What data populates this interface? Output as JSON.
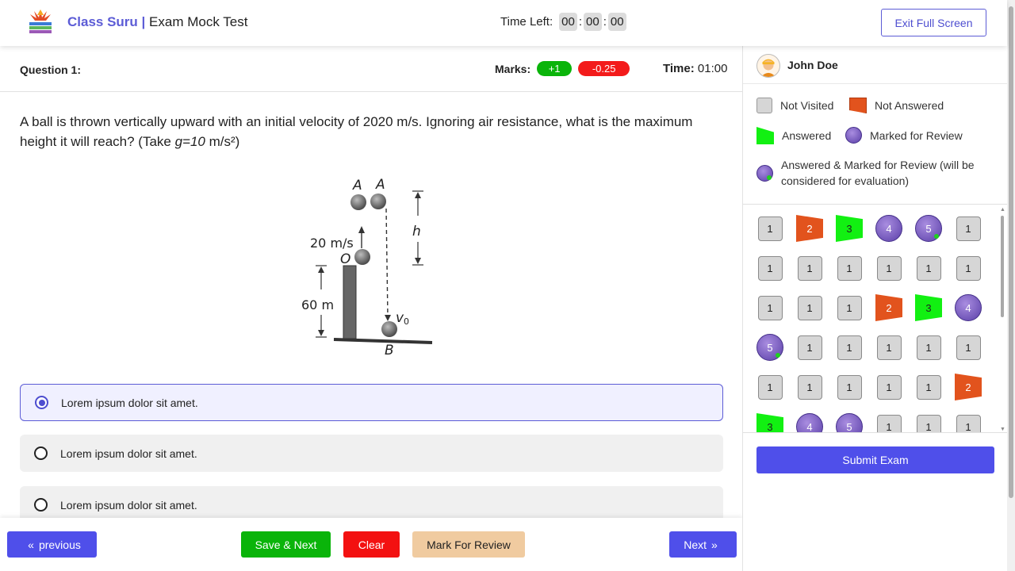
{
  "header": {
    "brand_accent": "Class Suru |",
    "title": "Exam Mock Test",
    "time_left_label": "Time Left:",
    "timer": [
      "00",
      "00",
      "00"
    ],
    "exit_label": "Exit Full Screen"
  },
  "question": {
    "label": "Question 1:",
    "marks_label": "Marks:",
    "positive": "+1",
    "negative": "-0.25",
    "time_label": "Time:",
    "time_value": "01:00",
    "text_part1": "A ball is thrown vertically upward with an initial velocity of 2020 m/s. Ignoring air resistance, what is the maximum height it will reach? (Take ",
    "text_g": "g=10",
    "text_part2": " m/s²)",
    "figure": {
      "label_a1": "A",
      "label_a2": "A",
      "label_h": "h",
      "label_velocity": "20 m/s",
      "label_o": "O",
      "label_height": "60 m",
      "label_v": "v",
      "label_v_sub": "0",
      "label_b": "B"
    }
  },
  "options": [
    {
      "label": "Lorem ipsum dolor sit amet.",
      "selected": true
    },
    {
      "label": "Lorem ipsum dolor sit amet.",
      "selected": false
    },
    {
      "label": "Lorem ipsum dolor sit amet.",
      "selected": false
    }
  ],
  "footer": {
    "previous": "previous",
    "save_next": "Save & Next",
    "clear": "Clear",
    "mark_review": "Mark For Review",
    "next": "Next"
  },
  "user": {
    "name": "John Doe"
  },
  "legend": {
    "not_visited": "Not Visited",
    "not_answered": "Not Answered",
    "answered": "Answered",
    "marked_review": "Marked for Review",
    "answered_marked_line1": "Answered & Marked for Review (will be",
    "answered_marked_line2": "considered for evaluation)"
  },
  "palette": [
    {
      "n": "1",
      "s": "nv"
    },
    {
      "n": "2",
      "s": "na"
    },
    {
      "n": "3",
      "s": "an"
    },
    {
      "n": "4",
      "s": "mr"
    },
    {
      "n": "5",
      "s": "amr"
    },
    {
      "n": "1",
      "s": "nv"
    },
    {
      "n": "1",
      "s": "nv"
    },
    {
      "n": "1",
      "s": "nv"
    },
    {
      "n": "1",
      "s": "nv"
    },
    {
      "n": "1",
      "s": "nv"
    },
    {
      "n": "1",
      "s": "nv"
    },
    {
      "n": "1",
      "s": "nv"
    },
    {
      "n": "1",
      "s": "nv"
    },
    {
      "n": "1",
      "s": "nv"
    },
    {
      "n": "1",
      "s": "nv"
    },
    {
      "n": "2",
      "s": "na"
    },
    {
      "n": "3",
      "s": "an"
    },
    {
      "n": "4",
      "s": "mr"
    },
    {
      "n": "5",
      "s": "amr"
    },
    {
      "n": "1",
      "s": "nv"
    },
    {
      "n": "1",
      "s": "nv"
    },
    {
      "n": "1",
      "s": "nv"
    },
    {
      "n": "1",
      "s": "nv"
    },
    {
      "n": "1",
      "s": "nv"
    },
    {
      "n": "1",
      "s": "nv"
    },
    {
      "n": "1",
      "s": "nv"
    },
    {
      "n": "1",
      "s": "nv"
    },
    {
      "n": "1",
      "s": "nv"
    },
    {
      "n": "1",
      "s": "nv"
    },
    {
      "n": "2",
      "s": "na"
    },
    {
      "n": "3",
      "s": "an"
    },
    {
      "n": "4",
      "s": "mr"
    },
    {
      "n": "5",
      "s": "mr"
    },
    {
      "n": "1",
      "s": "nv"
    },
    {
      "n": "1",
      "s": "nv"
    },
    {
      "n": "1",
      "s": "nv"
    }
  ],
  "submit_label": "Submit Exam",
  "colors": {
    "accent": "#4f4fea",
    "save": "#0ab40a",
    "clear": "#f31111",
    "mark": "#f0cba0",
    "not_answered": "#e2531d",
    "answered": "#12f012",
    "marked": "#6a4fb8"
  },
  "icons": {
    "previous": "double-chevron-left-icon",
    "next": "double-chevron-right-icon",
    "logo": "class-suru-logo",
    "avatar": "user-avatar"
  }
}
